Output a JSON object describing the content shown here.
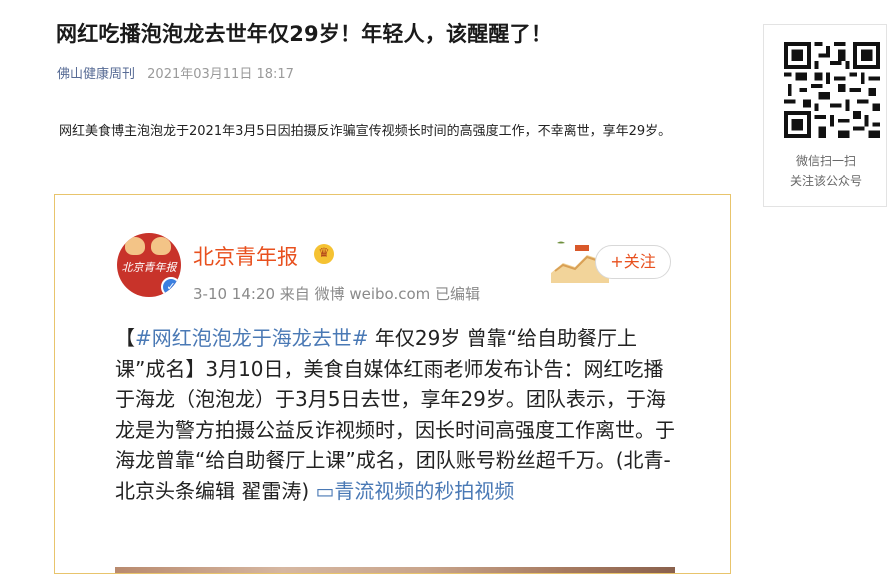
{
  "article": {
    "title": "网红吃播泡泡龙去世年仅29岁！年轻人，该醒醒了！",
    "author": "佛山健康周刊",
    "date": "2021年03月11日 18:17",
    "lead": "网红美食博主泡泡龙于2021年3月5日因拍摄反诈骗宣传视频长时间的高强度工作，不幸离世，享年29岁。"
  },
  "weibo_card": {
    "account_name": "北京青年报",
    "avatar_text": "北京青年报",
    "verified_mark": "✓",
    "crown_icon": "crown-icon",
    "meta": "3-10 14:20  来自 微博 weibo.com  已编辑",
    "follow_label": "+关注",
    "post": {
      "open_bracket": "【",
      "hashtag": "#网红泡泡龙于海龙去世#",
      "body": " 年仅29岁 曾靠“给自助餐厅上课”成名】3月10日，美食自媒体红雨老师发布讣告：网红吃播于海龙（泡泡龙）于3月5日去世，享年29岁。团队表示，于海龙是为警方拍摄公益反诈视频时，因长时间高强度工作离世。于海龙曾靠“给自助餐厅上课”成名，团队账号粉丝超千万。(北青-北京头条编辑 翟雷涛) ",
      "video_link": "▭青流视频的秒拍视频"
    }
  },
  "sidebar": {
    "qr_caption_line1": "微信扫一扫",
    "qr_caption_line2": "关注该公众号"
  },
  "colors": {
    "author_link": "#576b95",
    "weibo_orange": "#e8501e",
    "weibo_link": "#4a79b5",
    "embed_border": "#e8c46c"
  }
}
